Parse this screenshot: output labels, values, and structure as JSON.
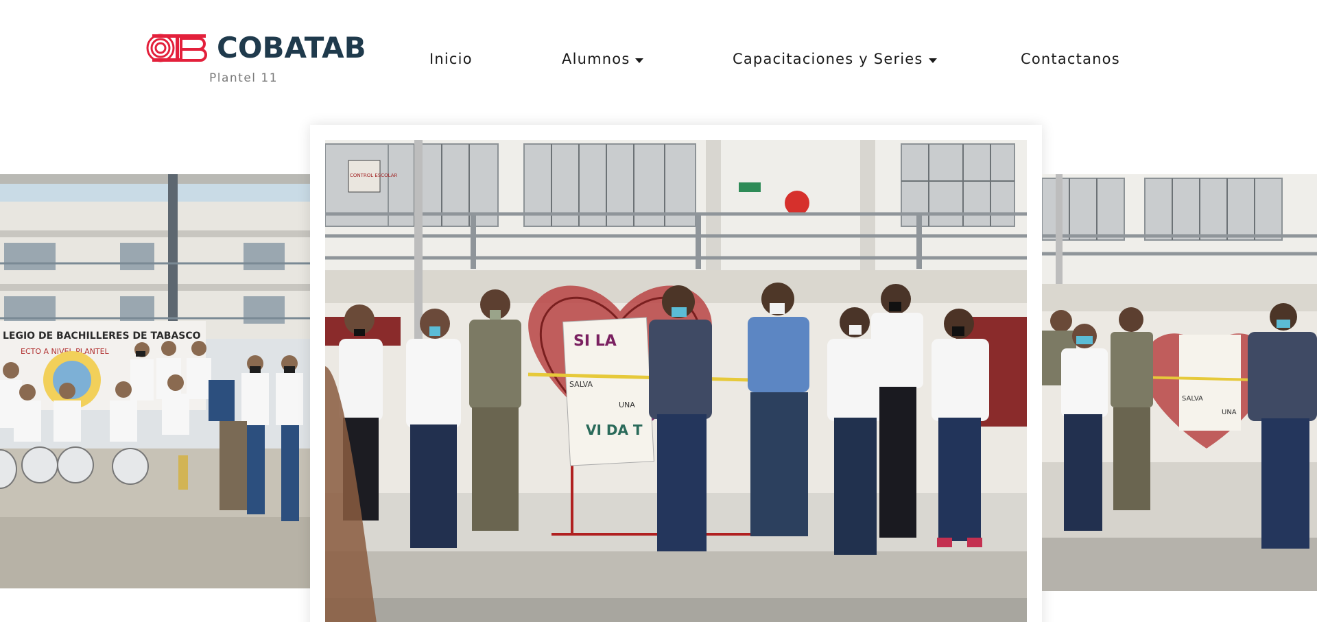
{
  "brand": {
    "name": "COBATAB",
    "subtitle": "Plantel 11",
    "accent_color": "#e3203b",
    "text_color": "#1f3a4c",
    "icon": "cobatab-logo-icon"
  },
  "nav": {
    "items": [
      {
        "label": "Inicio",
        "has_dropdown": false
      },
      {
        "label": "Alumnos",
        "has_dropdown": true
      },
      {
        "label": "Capacitaciones y Series",
        "has_dropdown": true
      },
      {
        "label": "Contactanos",
        "has_dropdown": false
      }
    ]
  },
  "carousel": {
    "left_slide": {
      "banner_line1": "LEGIO DE BACHILLERES DE TABASCO",
      "banner_line2": "ECTO A NIVEL PLANTEL"
    },
    "center_slide": {
      "sign_text": "CONTROL ESCOLAR",
      "poster_word1": "SI LA",
      "poster_word2": "SALVA",
      "poster_word3": "UNA",
      "poster_word4": "VI DA T"
    },
    "right_slide": {
      "poster_word2": "SALVA",
      "poster_word3": "UNA"
    }
  }
}
